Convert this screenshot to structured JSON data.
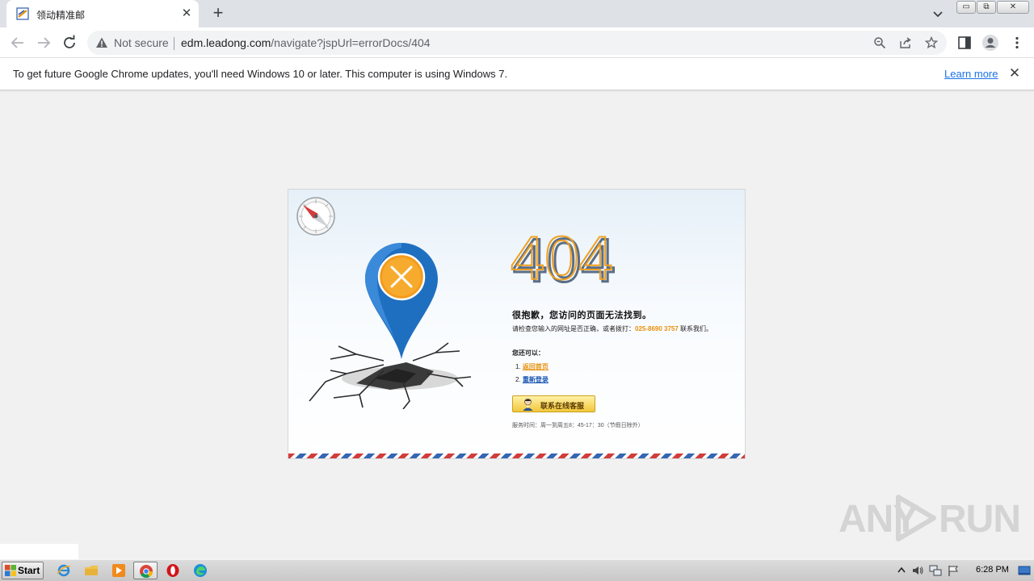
{
  "browser": {
    "tab": {
      "title": "领动精准邮",
      "favicon": "leadong-favicon"
    },
    "new_tab_label": "+",
    "security": {
      "label": "Not secure",
      "icon": "warning-triangle-icon"
    },
    "url": {
      "host": "edm.leadong.com",
      "path": "/navigate?jspUrl=errorDocs/404"
    },
    "window_controls": [
      "minimize-icon",
      "restore-icon",
      "close-icon"
    ],
    "toolbar_icons": [
      "zoom-icon",
      "share-icon",
      "bookmark-star-icon",
      "side-panel-icon",
      "profile-icon",
      "menu-icon"
    ]
  },
  "infobar": {
    "message": "To get future Google Chrome updates, you'll need Windows 10 or later. This computer is using Windows 7.",
    "link": "Learn more"
  },
  "error_page": {
    "code": "404",
    "headline": "很抱歉，您访问的页面无法找到。",
    "check_prefix": "请检查您输入的网址是否正确，或者拨打：",
    "phone": "025-8690 3757",
    "check_suffix": " 联系我们。",
    "you_can": "您还可以：",
    "options": [
      {
        "num": "1.",
        "label": "返回首页"
      },
      {
        "num": "2.",
        "label": "重新登录"
      }
    ],
    "contact_button": "联系在线客服",
    "service_time": "服务时间：周一到周五8：45-17：30（节假日除外）",
    "colors": {
      "accent_orange": "#e8900c",
      "pin_blue": "#1f6fc0",
      "link_blue": "#1a56b4"
    }
  },
  "watermark": {
    "left": "ANY",
    "right": "RUN"
  },
  "taskbar": {
    "start_label": "Start",
    "apps": [
      "ie-icon",
      "explorer-folder-icon",
      "media-player-icon",
      "chrome-icon",
      "opera-icon",
      "edge-icon"
    ],
    "tray_icons": [
      "show-hidden-icon",
      "volume-icon",
      "network-icon",
      "action-center-flag-icon"
    ],
    "clock": "6:28 PM"
  }
}
